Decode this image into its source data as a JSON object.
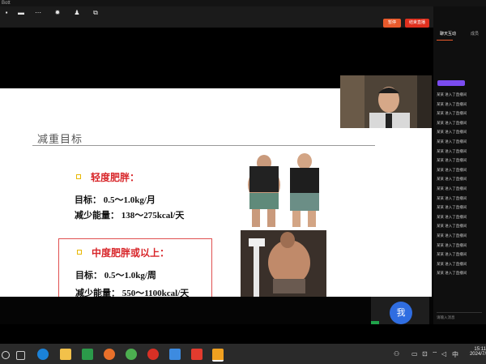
{
  "titlebar": {
    "title": "Bott"
  },
  "toolbar": {
    "items": [
      "",
      "",
      "",
      "",
      "",
      "",
      ""
    ],
    "share_label": "暂停",
    "end_label": "结束直播"
  },
  "slide": {
    "title": "减重目标",
    "section1": {
      "heading": "轻度肥胖：",
      "line1": "目标：  0.5～1.0kg/月",
      "line2": "减少能量：  138～275kcal/天"
    },
    "section2": {
      "heading": "中度肥胖或以上：",
      "line1": "目标：  0.5～1.0kg/周",
      "line2": "减少能量：  550～1100kcal/天"
    }
  },
  "self_view": {
    "label": "我"
  },
  "sidebar": {
    "header": "",
    "tabs": [
      "聊天互动",
      "成员"
    ],
    "entries": [
      "某某 进入了直播间",
      "某某 进入了直播间",
      "某某 进入了直播间",
      "某某 进入了直播间",
      "某某 进入了直播间",
      "某某 进入了直播间",
      "某某 进入了直播间",
      "某某 进入了直播间",
      "某某 进入了直播间",
      "某某 进入了直播间",
      "某某 进入了直播间",
      "某某 进入了直播间",
      "某某 进入了直播间",
      "某某 进入了直播间",
      "某某 进入了直播间",
      "某某 进入了直播间",
      "某某 进入了直播间",
      "某某 进入了直播间",
      "某某 进入了直播间",
      "某某 进入了直播间"
    ],
    "input_placeholder": "请输入消息"
  },
  "taskbar": {
    "clock_time": "15:11",
    "clock_date": "2024/7/",
    "ime": "中"
  },
  "colors": {
    "accent_orange": "#e85a2c",
    "end_red": "#e0301e",
    "slide_red": "#d8262a",
    "bullet_yellow": "#e8b800",
    "self_blue": "#2f6de1",
    "chip_purple": "#7b4cf0"
  }
}
